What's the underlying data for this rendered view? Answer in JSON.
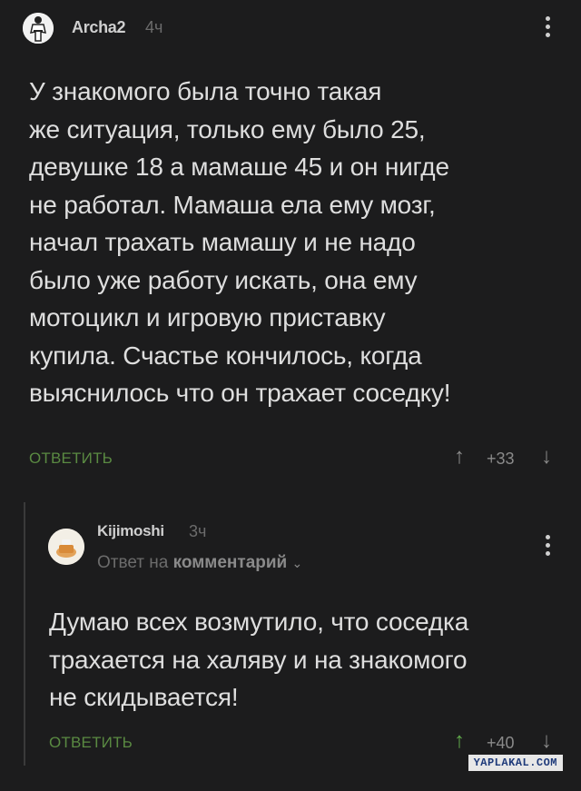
{
  "comments": [
    {
      "author": "Archa2",
      "time": "4ч",
      "text_lines": [
        "У знакомого была точно такая",
        "же  ситуация, только ему было 25,",
        "девушке 18 а мамаше 45 и он нигде",
        "не работал. Мамаша ела ему мозг,",
        "начал трахать мамашу и не надо",
        "было уже работу искать, она ему",
        "мотоцикл и игровую приставку",
        "купила. Счастье кончилось, когда",
        "выяснилось что он трахает соседку!"
      ],
      "reply_label": "ОТВЕТИТЬ",
      "score": "+33"
    },
    {
      "author": "Kijimoshi",
      "time": "3ч",
      "reply_to_prefix": "Ответ на",
      "reply_to_link": "комментарий",
      "text_lines": [
        "Думаю всех возмутило, что соседка",
        "трахается на халяву и на знакомого",
        "не скидывается!"
      ],
      "reply_label": "ОТВЕТИТЬ",
      "score": "+40"
    }
  ],
  "watermark": "YAPLAKAL.COM",
  "colors": {
    "background": "#1c1c1d",
    "reply_green": "#5a8a42",
    "upvote_active": "#5fa84a"
  }
}
